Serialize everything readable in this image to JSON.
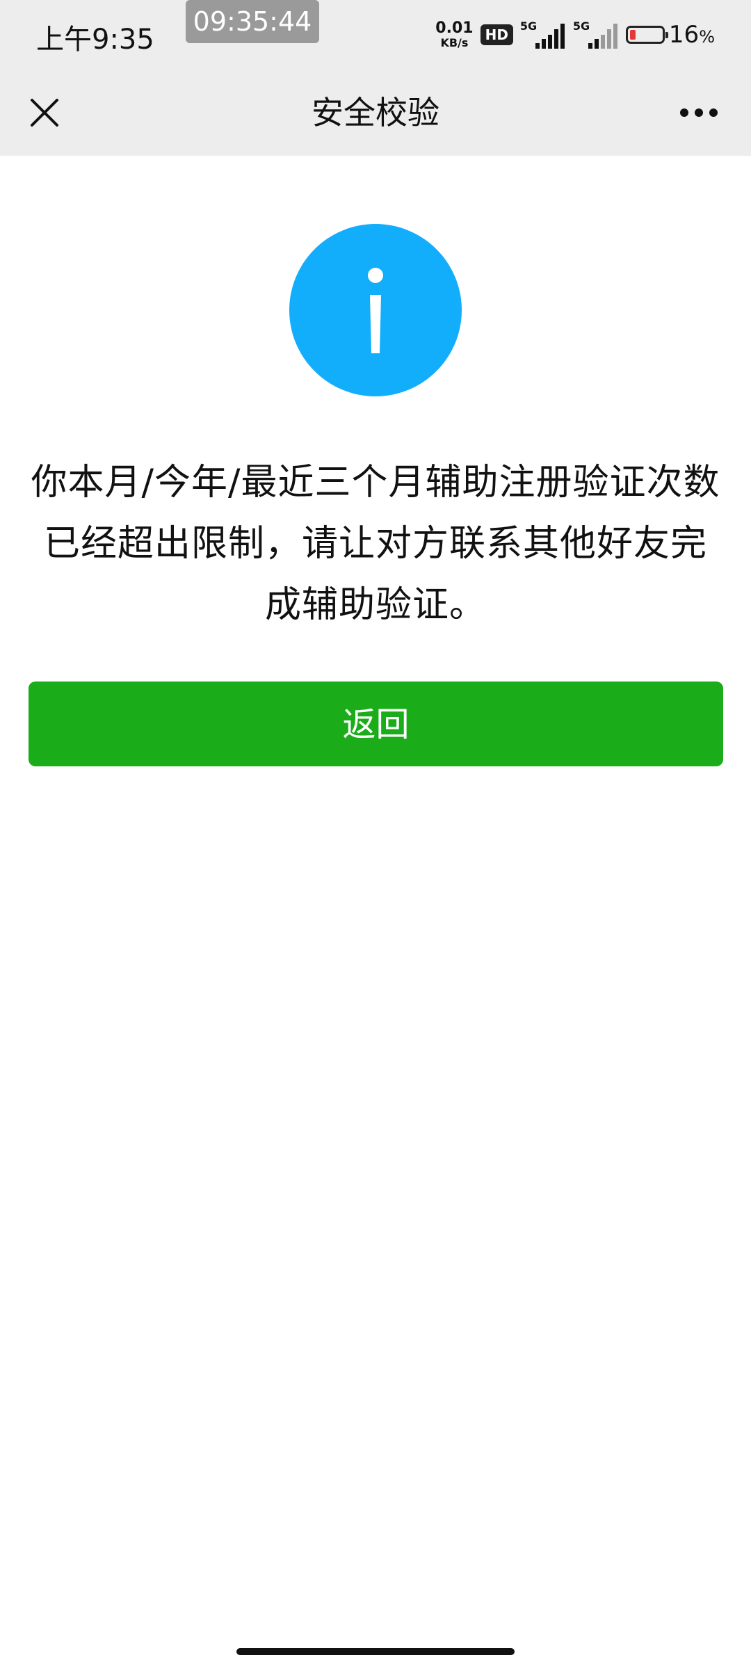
{
  "status_bar": {
    "time": "上午9:35",
    "screen_recording_timer": "09:35:44",
    "net_speed_value": "0.01",
    "net_speed_unit": "KB/s",
    "hd_badge": "HD",
    "sim1_label": "5G",
    "sim2_label": "5G",
    "battery_value": "16",
    "battery_unit": "%",
    "battery_color": "#e53935"
  },
  "nav": {
    "title": "安全校验",
    "close_icon": "close-icon",
    "more_icon": "more-dots-icon"
  },
  "content": {
    "icon": "info-icon",
    "icon_color": "#12aefc",
    "message": "你本月/今年/最近三个月辅助注册验证次数已经超出限制，请让对方联系其他好友完成辅助验证。",
    "back_button_label": "返回",
    "button_color": "#1aad19"
  }
}
